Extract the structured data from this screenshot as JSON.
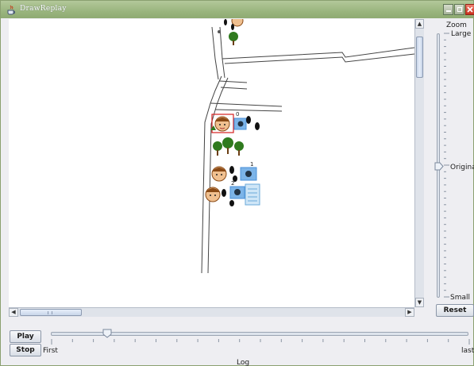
{
  "window": {
    "title": "DrawReplay",
    "minimize_icon": "minimize-icon",
    "maximize_icon": "maximize-icon",
    "close_icon": "close-icon"
  },
  "map": {
    "markers": [
      {
        "kind": "person",
        "label": "0"
      },
      {
        "kind": "person",
        "label": "1"
      },
      {
        "kind": "person",
        "label": "2"
      }
    ],
    "icons": [
      "tree-icon",
      "footprints-icon",
      "camera-icon",
      "memo-icon",
      "person-face-icon"
    ]
  },
  "zoom": {
    "label": "Zoom",
    "large": "Large",
    "original": "Original",
    "small": "Small",
    "level": 0.5,
    "reset": "Reset"
  },
  "controls": {
    "play": "Play",
    "stop": "Stop"
  },
  "log": {
    "first": "First",
    "last": "last",
    "title": "Log",
    "position": 0.135
  },
  "colors": {
    "titlebar": "#9ab57e",
    "tree": "#2f7a1e",
    "camera": "#4a90d9",
    "face": "#f0c090",
    "hair": "#8a4a16"
  }
}
